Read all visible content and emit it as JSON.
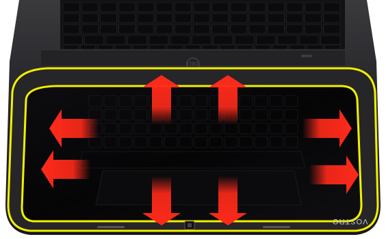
{
  "figure": {
    "brand_label": "VOSTRO",
    "colors": {
      "outline_yellow": "#f2f000",
      "arrow_red": "#ff2a1a",
      "chassis_dark": "#1e1e20",
      "chassis_mid": "#2c2c2e",
      "keys": "#101012",
      "key_label": "#8f8f8f",
      "key_label_red": "#b33030",
      "palm_gloss": "#0a0a0c"
    },
    "icons": [
      "laptop-base",
      "keyboard",
      "palmrest-outline",
      "palmrest-inner-outline",
      "arrow-up",
      "arrow-down",
      "arrow-left",
      "arrow-right",
      "power-button-icon"
    ],
    "arrow_count": 8
  }
}
